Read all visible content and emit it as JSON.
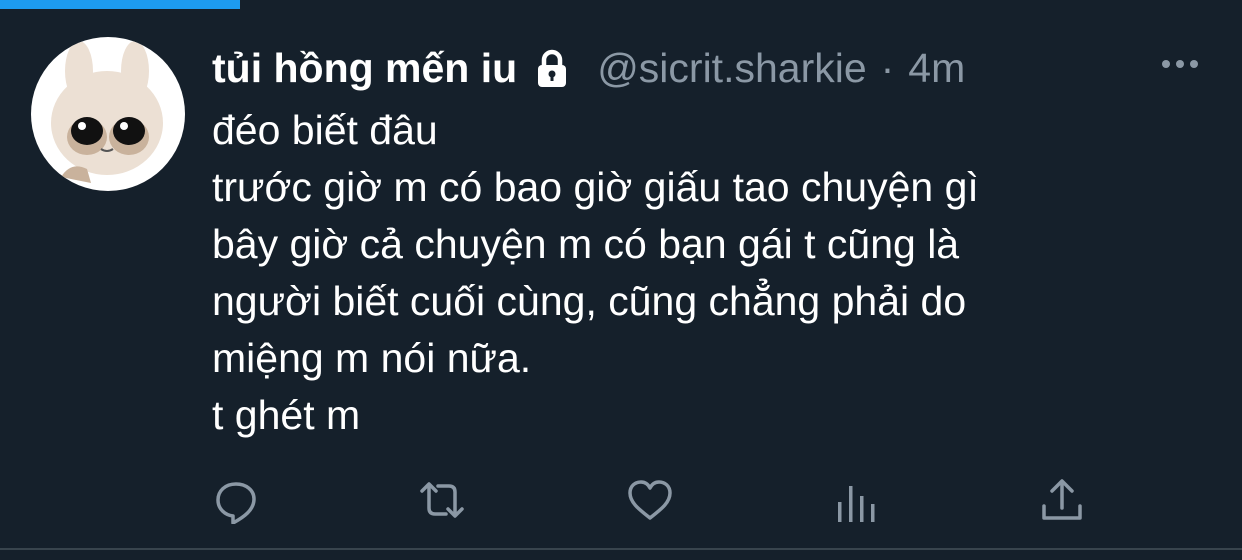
{
  "tweet": {
    "display_name": "tủi hồng mến iu",
    "handle": "@sicrit.sharkie",
    "separator": "·",
    "time": "4m",
    "lines": [
      "đéo biết đâu",
      "trước giờ m có bao giờ giấu tao chuyện gì",
      "bây giờ cả chuyện m có bạn gái t cũng là",
      "người biết cuối cùng, cũng chẳng phải do",
      "miệng m nói nữa.",
      "t ghét m"
    ]
  },
  "icons": {
    "lock": "lock-icon",
    "more": "more-icon",
    "reply": "reply-icon",
    "retweet": "retweet-icon",
    "like": "heart-icon",
    "analytics": "analytics-icon",
    "share": "share-icon"
  },
  "colors": {
    "background": "#15202b",
    "text": "#ffffff",
    "secondary": "#8b98a5",
    "accent": "#1d9bf0",
    "divider": "#38444d"
  }
}
